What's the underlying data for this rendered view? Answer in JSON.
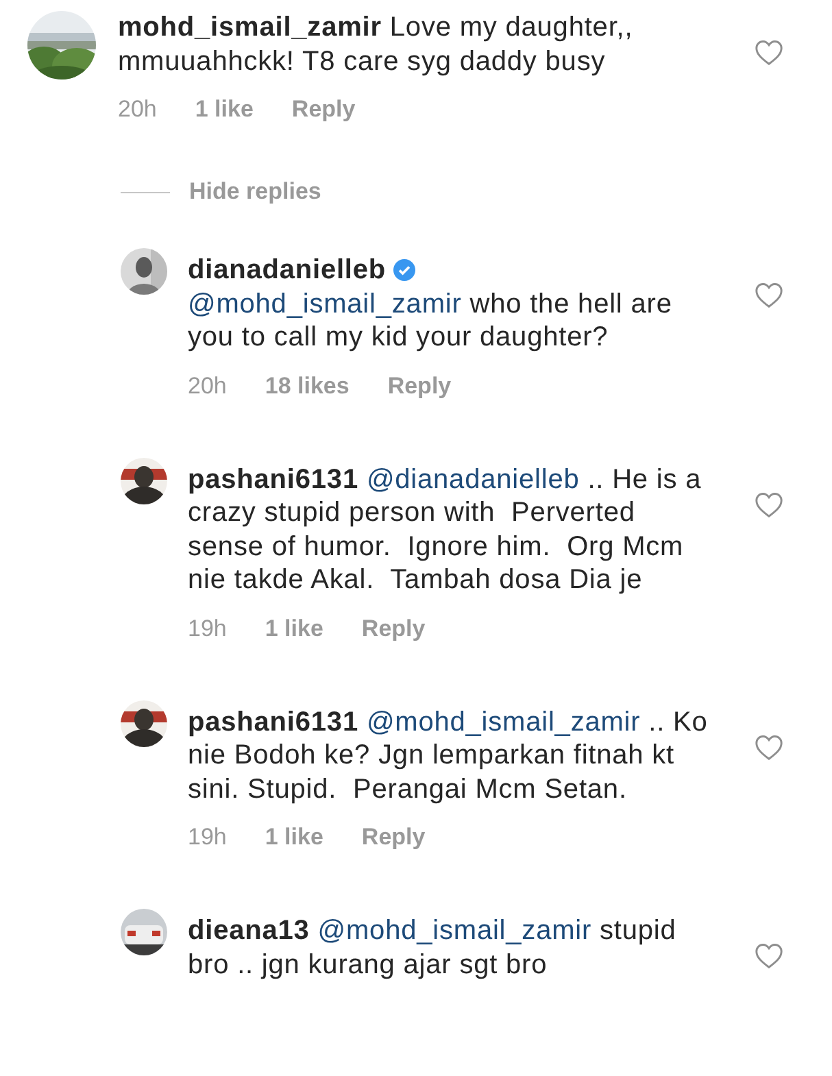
{
  "comment": {
    "username": "mohd_ismail_zamir",
    "verified": false,
    "text": "Love my daughter,, mmuuahhckk! T8 care syg daddy busy",
    "time": "20h",
    "likes": "1 like",
    "reply": "Reply",
    "liked": false
  },
  "hide_replies": "Hide replies",
  "replies": [
    {
      "username": "dianadanielleb",
      "verified": true,
      "mention": "@mohd_ismail_zamir",
      "text": "who the hell are you to call my kid your daughter?",
      "time": "20h",
      "likes": "18 likes",
      "reply": "Reply",
      "liked": false
    },
    {
      "username": "pashani6131",
      "verified": false,
      "mention": "@dianadanielleb",
      "text": ".. He is a crazy stupid person with  Perverted sense of humor.  Ignore him.  Org Mcm nie takde Akal.  Tambah dosa Dia je",
      "time": "19h",
      "likes": "1 like",
      "reply": "Reply",
      "liked": false
    },
    {
      "username": "pashani6131",
      "verified": false,
      "mention": "@mohd_ismail_zamir",
      "text": ".. Ko nie Bodoh ke? Jgn lemparkan fitnah kt sini. Stupid.  Perangai Mcm Setan.",
      "time": "19h",
      "likes": "1 like",
      "reply": "Reply",
      "liked": false
    },
    {
      "username": "dieana13",
      "verified": false,
      "mention": "@mohd_ismail_zamir",
      "text": "stupid bro .. jgn kurang ajar sgt bro",
      "liked": false
    }
  ]
}
